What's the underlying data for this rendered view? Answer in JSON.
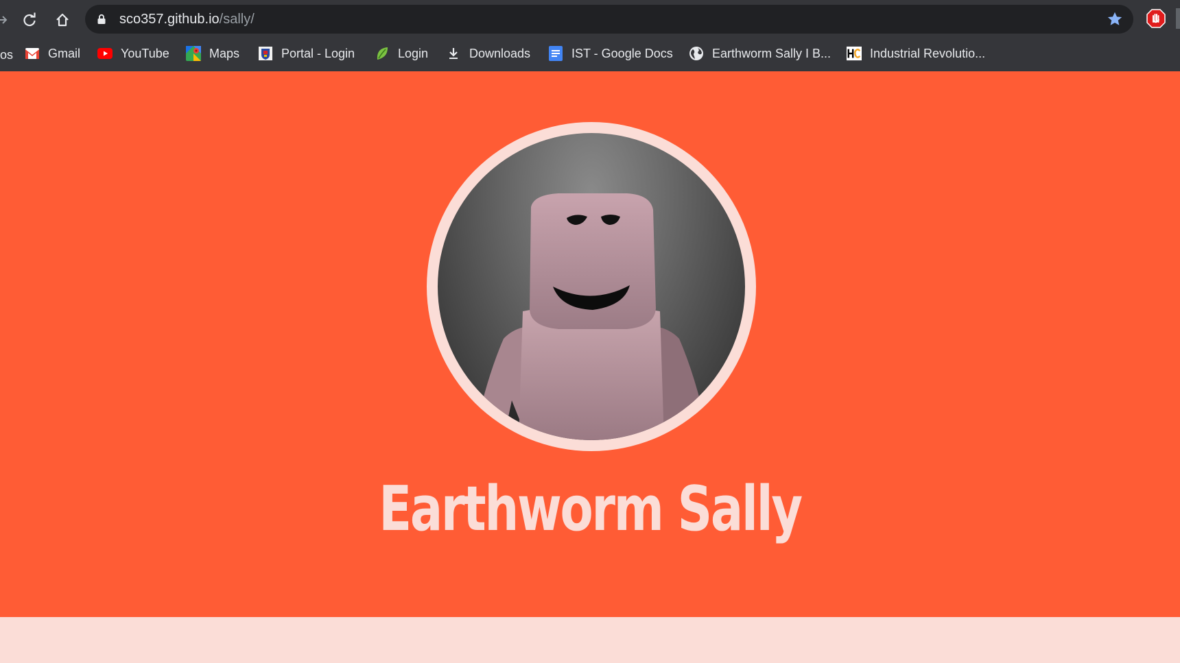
{
  "browser": {
    "url_host": "sco357.github.io",
    "url_path": "/sally/",
    "bookmarks_cut_label": "os",
    "bookmarks": [
      {
        "label": "Gmail",
        "icon": "gmail-icon"
      },
      {
        "label": "YouTube",
        "icon": "youtube-icon"
      },
      {
        "label": "Maps",
        "icon": "maps-icon"
      },
      {
        "label": "Portal - Login",
        "icon": "portal-crest-icon"
      },
      {
        "label": "Login",
        "icon": "leaf-icon"
      },
      {
        "label": "Downloads",
        "icon": "download-icon"
      },
      {
        "label": "IST - Google Docs",
        "icon": "google-docs-icon"
      },
      {
        "label": "Earthworm Sally I B...",
        "icon": "globe-icon"
      },
      {
        "label": "Industrial Revolutio...",
        "icon": "hc-icon"
      }
    ]
  },
  "page": {
    "title": "Earthworm Sally",
    "colors": {
      "hero": "#ff5c35",
      "accent": "#fbddd7"
    }
  }
}
